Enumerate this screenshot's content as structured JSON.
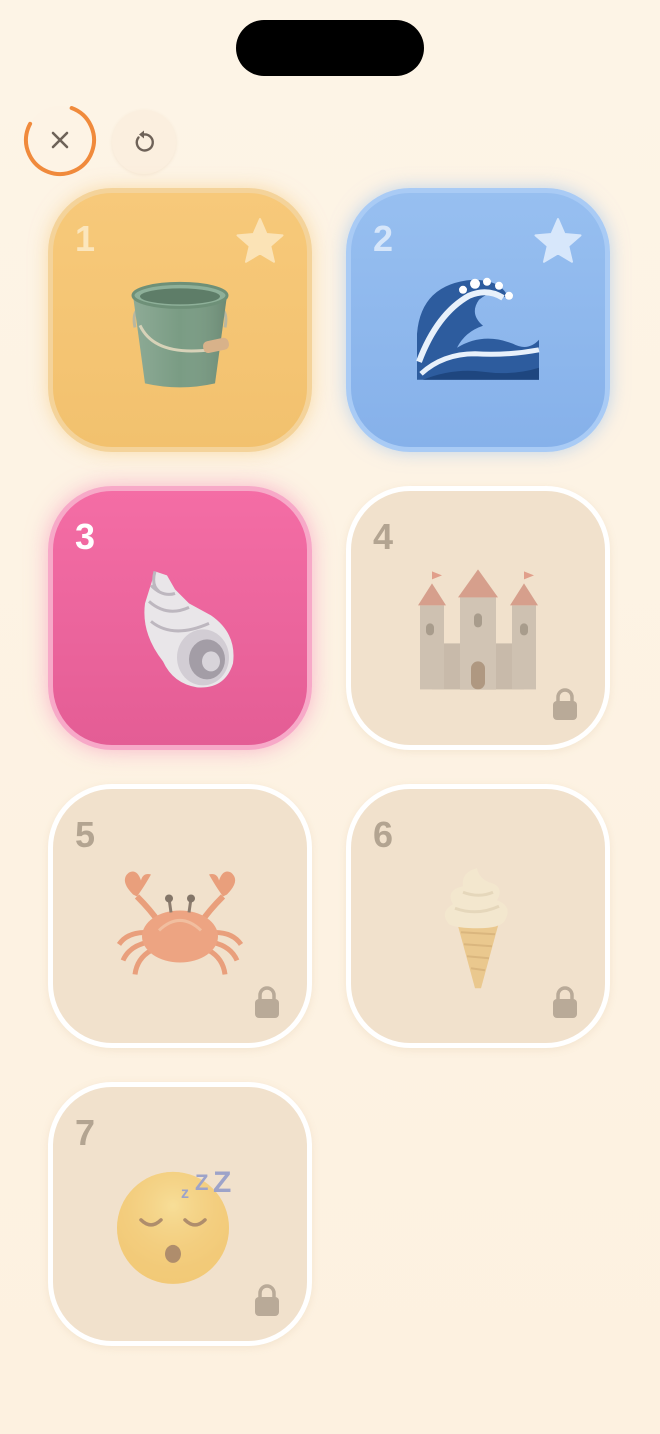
{
  "header": {
    "close_icon": "close-icon",
    "reset_icon": "reset-icon",
    "progress_ring_color": "#f08a3c"
  },
  "levels": [
    {
      "number": "1",
      "icon": "sand-bucket",
      "state": "completed",
      "starred": true,
      "color": "#f5c674"
    },
    {
      "number": "2",
      "icon": "ocean-wave",
      "state": "completed",
      "starred": true,
      "color": "#8db6ed"
    },
    {
      "number": "3",
      "icon": "spiral-shell",
      "state": "current",
      "starred": false,
      "color": "#ee649e"
    },
    {
      "number": "4",
      "icon": "castle",
      "state": "locked",
      "starred": false,
      "color": "#f1e1cc"
    },
    {
      "number": "5",
      "icon": "crab",
      "state": "locked",
      "starred": false,
      "color": "#f1e1cc"
    },
    {
      "number": "6",
      "icon": "soft-ice-cream",
      "state": "locked",
      "starred": false,
      "color": "#f1e1cc"
    },
    {
      "number": "7",
      "icon": "sleeping-face",
      "state": "locked",
      "starred": false,
      "color": "#f1e1cc"
    }
  ]
}
